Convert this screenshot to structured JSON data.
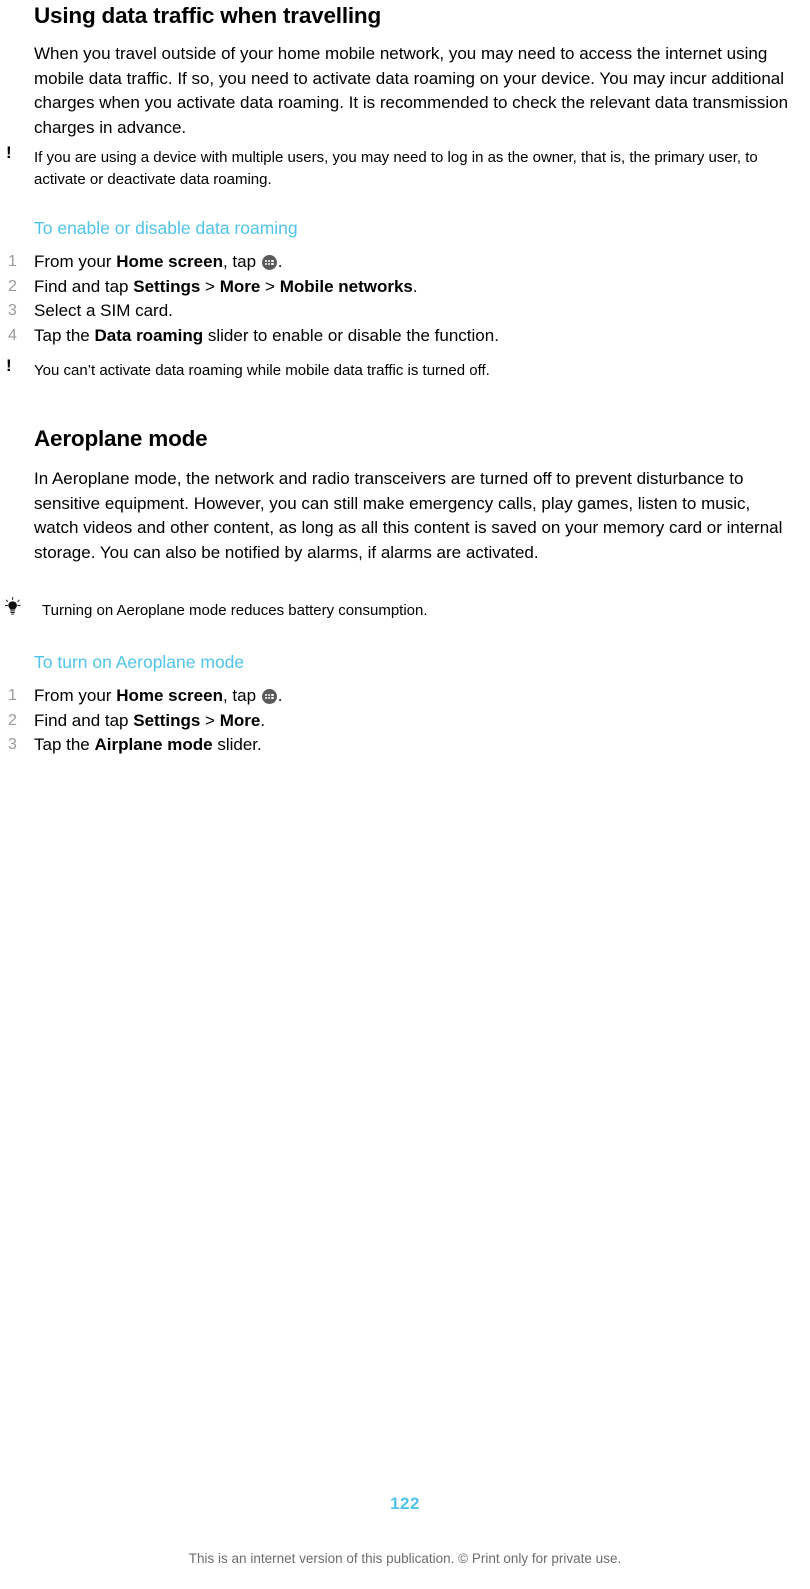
{
  "document": {
    "page_number": "122",
    "footer_text": "This is an internet version of this publication. © Print only for private use.",
    "accent_color": "#4FC3E8",
    "step_number_color": "#9a9a9a",
    "footer_color": "#6d6d6d"
  },
  "section_one": {
    "title": "Using data traffic when travelling",
    "body": "When you travel outside of your home mobile network, you may need to access the internet using mobile data traffic. If so, you need to activate data roaming on your device. You may incur additional charges when you activate data roaming. It is recommended to check the relevant data transmission charges in advance.",
    "note_icon": "exclamation-icon",
    "note": "If you are using a device with multiple users, you may need to log in as the owner, that is, the primary user, to activate or deactivate data roaming.",
    "procedure_heading": "To enable or disable data roaming",
    "steps": [
      {
        "num": "1",
        "pre": "From your ",
        "bold1": "Home screen",
        "mid": ", tap ",
        "icon": "app-drawer-icon",
        "post": "."
      },
      {
        "num": "2",
        "pre": "Find and tap ",
        "bold1": "Settings",
        "sep1": " > ",
        "bold2": "More",
        "sep2": " > ",
        "bold3": "Mobile networks",
        "post": "."
      },
      {
        "num": "3",
        "pre": "Select a SIM card.",
        "post": ""
      },
      {
        "num": "4",
        "pre": "Tap the ",
        "bold1": "Data roaming",
        "post": " slider to enable or disable the function."
      }
    ],
    "note2_icon": "exclamation-icon",
    "note2": "You can’t activate data roaming while mobile data traffic is turned off."
  },
  "section_two": {
    "title": "Aeroplane mode",
    "body": "In Aeroplane mode, the network and radio transceivers are turned off to prevent disturbance to sensitive equipment. However, you can still make emergency calls, play games, listen to music, watch videos and other content, as long as all this content is saved on your memory card or internal storage. You can also be notified by alarms, if alarms are activated.",
    "tip_icon": "lightbulb-icon",
    "tip": "Turning on Aeroplane mode reduces battery consumption.",
    "procedure_heading": "To turn on Aeroplane mode",
    "steps": [
      {
        "num": "1",
        "pre": "From your ",
        "bold1": "Home screen",
        "mid": ", tap ",
        "icon": "app-drawer-icon",
        "post": "."
      },
      {
        "num": "2",
        "pre": "Find and tap ",
        "bold1": "Settings",
        "sep1": " > ",
        "bold2": "More",
        "post": "."
      },
      {
        "num": "3",
        "pre": "Tap the ",
        "bold1": "Airplane mode",
        "post": " slider."
      }
    ]
  }
}
